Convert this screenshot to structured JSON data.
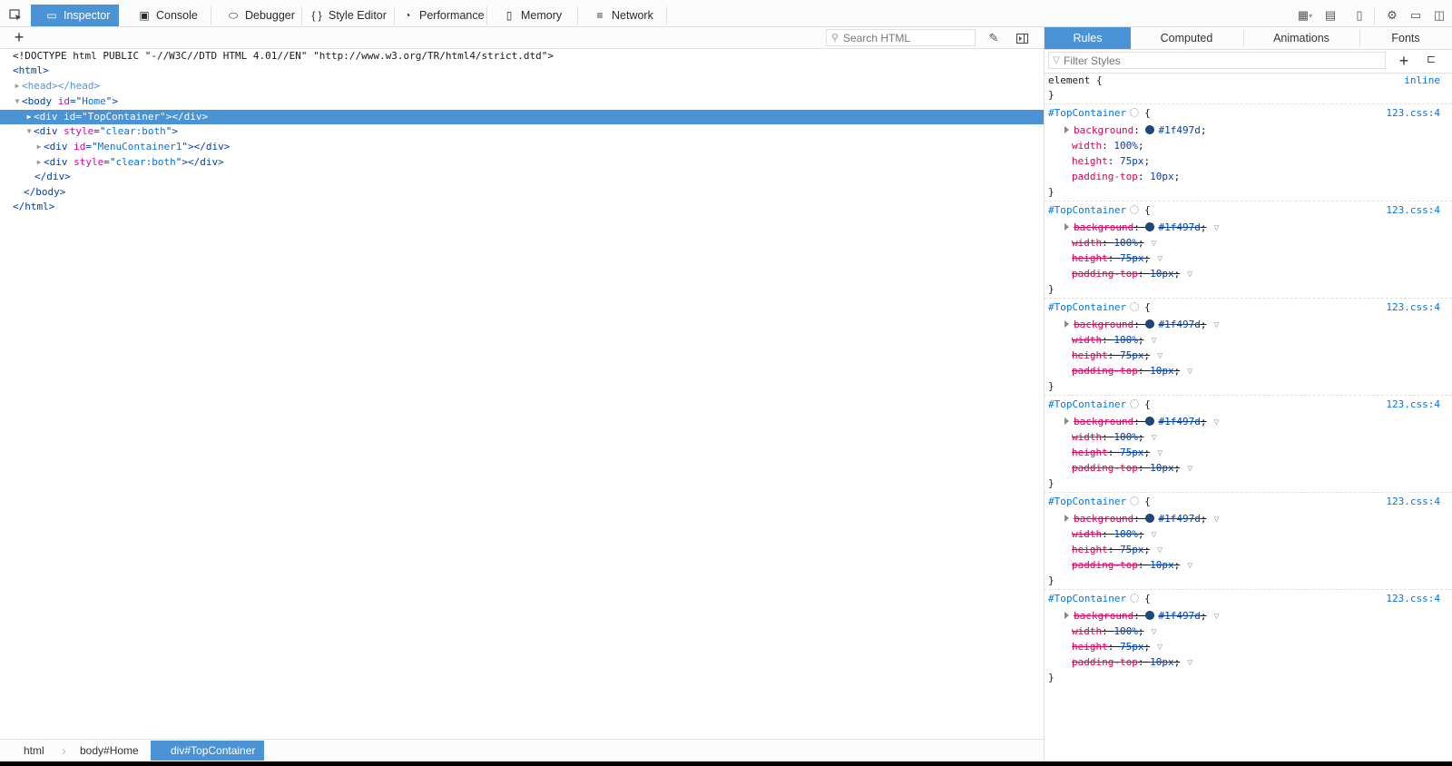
{
  "toolbar": {
    "tabs": [
      {
        "label": "Inspector",
        "icon": "inspector-icon"
      },
      {
        "label": "Console",
        "icon": "console-icon"
      },
      {
        "label": "Debugger",
        "icon": "debugger-icon"
      },
      {
        "label": "Style Editor",
        "icon": "style-editor-icon"
      },
      {
        "label": "Performance",
        "icon": "performance-icon"
      },
      {
        "label": "Memory",
        "icon": "memory-icon"
      },
      {
        "label": "Network",
        "icon": "network-icon"
      }
    ],
    "style_editor_glyph": "{ }",
    "selected_tab": "Inspector"
  },
  "markup": {
    "search_placeholder": "Search HTML",
    "lines": [
      {
        "text": "<!DOCTYPE html PUBLIC \"-//W3C//DTD HTML 4.01//EN\" \"http://www.w3.org/TR/html4/strict.dtd\">"
      },
      {
        "tag_open": "<html>"
      },
      {
        "tag_open": "<head></head>"
      },
      {
        "tag": "body",
        "attr": "id",
        "val": "Home"
      },
      {
        "tag": "div",
        "attr": "id",
        "val": "TopContainer",
        "close": "</div>"
      },
      {
        "tag": "div",
        "attr": "style",
        "val": "clear:both"
      },
      {
        "tag": "div",
        "attr": "id",
        "val": "MenuContainer1",
        "close": "</div>"
      },
      {
        "tag": "div",
        "attr": "style",
        "val": "clear:both",
        "close": "</div>"
      },
      {
        "tag_open": "</div>"
      },
      {
        "tag_open": "</body>"
      },
      {
        "tag_open": "</html>"
      }
    ]
  },
  "breadcrumbs": [
    "html",
    "body#Home",
    "div#TopContainer"
  ],
  "sidebar": {
    "tabs": [
      "Rules",
      "Computed",
      "Animations",
      "Fonts"
    ],
    "selected_tab": "Rules",
    "filter_placeholder": "Filter Styles",
    "element_rule": {
      "selector": "element {",
      "source": "inline",
      "close": "}"
    },
    "rules": [
      {
        "selector": "#TopContainer",
        "brace": "{",
        "source": "123.css:4",
        "overridden": false,
        "props": [
          {
            "name": "background",
            "value": "#1f497d"
          },
          {
            "name": "width",
            "value": "100%"
          },
          {
            "name": "height",
            "value": "75px"
          },
          {
            "name": "padding-top",
            "value": "10px"
          }
        ]
      },
      {
        "selector": "#TopContainer",
        "brace": "{",
        "source": "123.css:4",
        "overridden": true,
        "props": [
          {
            "name": "background",
            "value": "#1f497d"
          },
          {
            "name": "width",
            "value": "100%"
          },
          {
            "name": "height",
            "value": "75px"
          },
          {
            "name": "padding-top",
            "value": "10px"
          }
        ]
      },
      {
        "selector": "#TopContainer",
        "brace": "{",
        "source": "123.css:4",
        "overridden": true,
        "props": [
          {
            "name": "background",
            "value": "#1f497d"
          },
          {
            "name": "width",
            "value": "100%"
          },
          {
            "name": "height",
            "value": "75px"
          },
          {
            "name": "padding-top",
            "value": "10px"
          }
        ]
      },
      {
        "selector": "#TopContainer",
        "brace": "{",
        "source": "123.css:4",
        "overridden": true,
        "props": [
          {
            "name": "background",
            "value": "#1f497d"
          },
          {
            "name": "width",
            "value": "100%"
          },
          {
            "name": "height",
            "value": "75px"
          },
          {
            "name": "padding-top",
            "value": "10px"
          }
        ]
      },
      {
        "selector": "#TopContainer",
        "brace": "{",
        "source": "123.css:4",
        "overridden": true,
        "props": [
          {
            "name": "background",
            "value": "#1f497d"
          },
          {
            "name": "width",
            "value": "100%"
          },
          {
            "name": "height",
            "value": "75px"
          },
          {
            "name": "padding-top",
            "value": "10px"
          }
        ]
      },
      {
        "selector": "#TopContainer",
        "brace": "{",
        "source": "123.css:4",
        "overridden": true,
        "props": [
          {
            "name": "background",
            "value": "#1f497d"
          },
          {
            "name": "width",
            "value": "100%"
          },
          {
            "name": "height",
            "value": "75px"
          },
          {
            "name": "padding-top",
            "value": "10px"
          }
        ]
      }
    ]
  },
  "colors": {
    "accent": "#4a94d6",
    "swatch": "#1f497d"
  }
}
